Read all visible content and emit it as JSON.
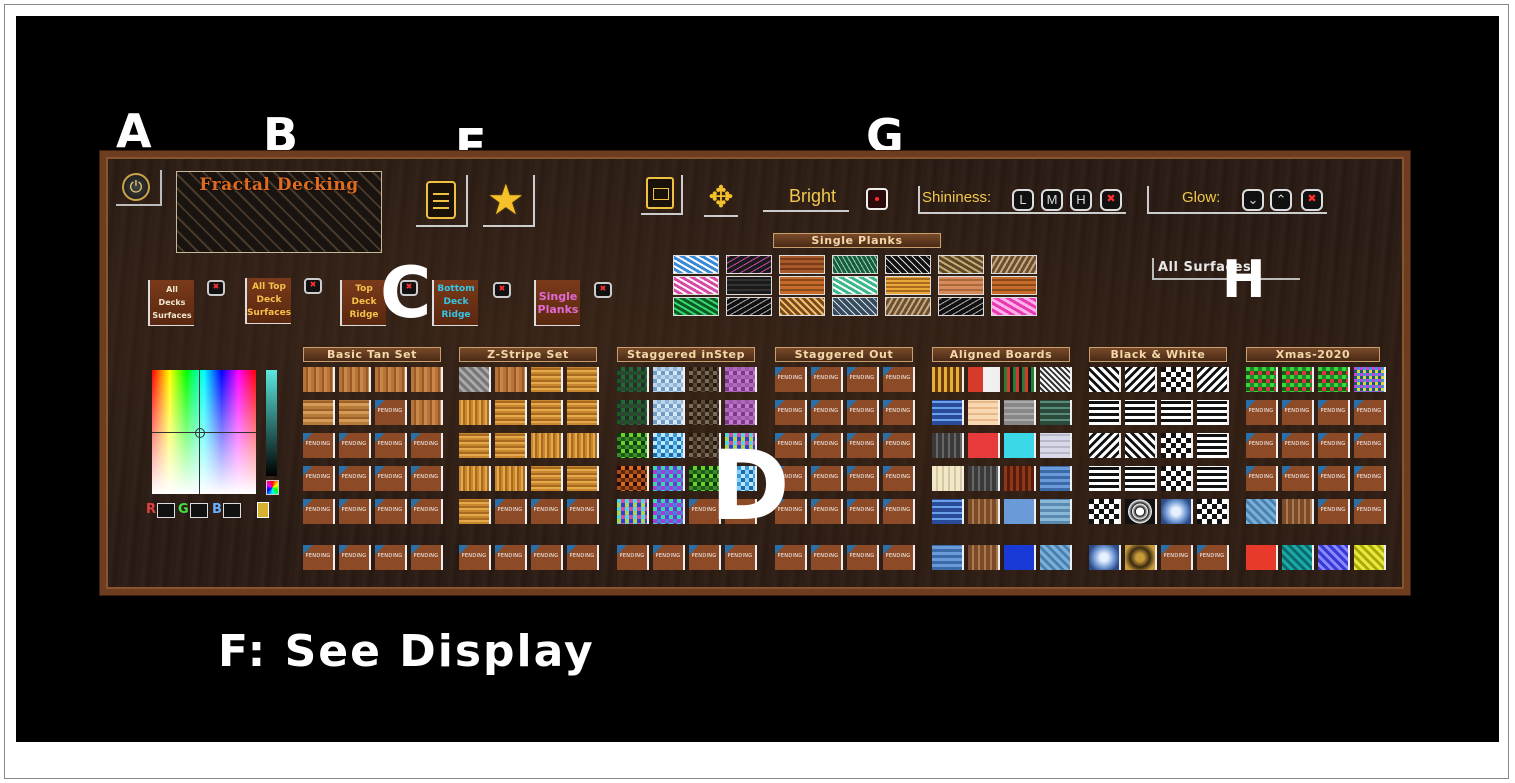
{
  "labels": {
    "a": "A",
    "b": "B",
    "c": "C",
    "d": "D",
    "e": "E",
    "g": "G",
    "h": "H",
    "f_caption": "F: See Display"
  },
  "logo": {
    "title": "Fractal Decking"
  },
  "toolbar": {
    "bright_label": "Bright",
    "shininess_label": "Shininess:",
    "shininess_levels": [
      "L",
      "M",
      "H"
    ],
    "glow_label": "Glow:",
    "glow_down": "⌄",
    "glow_up": "⌃"
  },
  "surfaces": [
    {
      "label": "All Decks Surfaces",
      "color": "white"
    },
    {
      "label": "All Top Deck Surfaces",
      "color": "yellow"
    },
    {
      "label": "Top Deck Ridge",
      "color": "yellow"
    },
    {
      "label": "Bottom Deck Ridge",
      "color": "cyan"
    },
    {
      "label": "Single Planks",
      "color": "pink"
    }
  ],
  "single_planks_header": "Single Planks",
  "all_surfaces_label": "All Surfaces",
  "texture_sets": [
    {
      "name": "Basic Tan Set"
    },
    {
      "name": "Z-Stripe Set"
    },
    {
      "name": "Staggered inStep"
    },
    {
      "name": "Staggered Out"
    },
    {
      "name": "Aligned Boards"
    },
    {
      "name": "Black & White"
    },
    {
      "name": "Xmas-2020"
    }
  ],
  "pending_text": "PENDING",
  "color_picker": {
    "r_label": "R",
    "g_label": "G",
    "b_label": "B"
  },
  "colors": {
    "accent_yellow": "#f2c94c",
    "board_frame": "#6e3d1f",
    "close_red": "#ff3030"
  }
}
